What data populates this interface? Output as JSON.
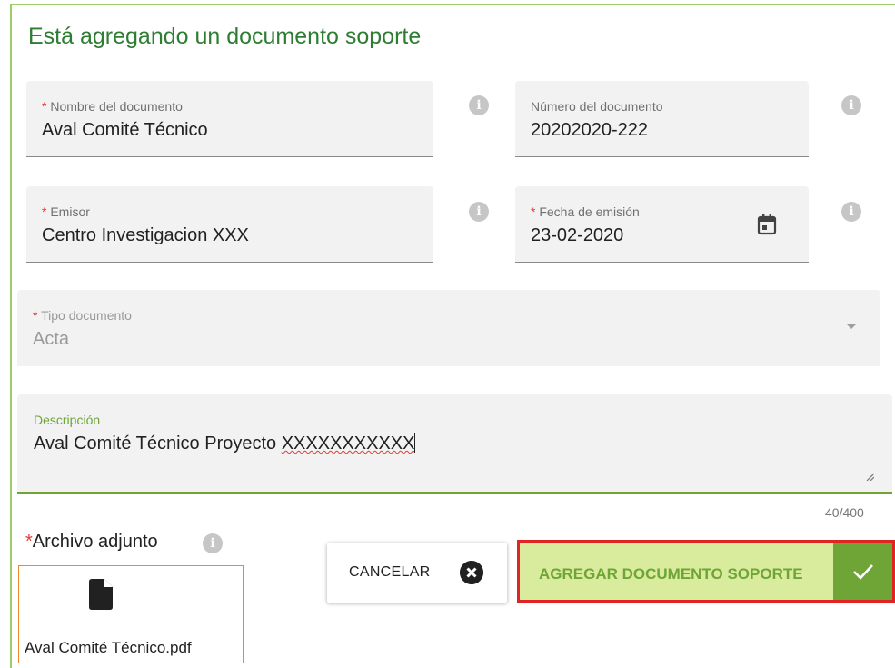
{
  "dialog": {
    "title": "Está agregando un documento soporte"
  },
  "fields": {
    "nombre": {
      "required": "*",
      "label": "Nombre del documento",
      "value": "Aval Comité Técnico"
    },
    "numero": {
      "label": "Número del documento",
      "value": "20202020-222"
    },
    "emisor": {
      "required": "*",
      "label": "Emisor",
      "value": "Centro Investigacion XXX"
    },
    "fecha": {
      "required": "*",
      "label": "Fecha de emisión",
      "value": "23-02-2020"
    },
    "tipo": {
      "required": "*",
      "label": "Tipo documento",
      "value": "Acta"
    },
    "descripcion": {
      "label": "Descripción",
      "value_prefix": "Aval Comité Técnico Proyecto ",
      "value_misspelled": "XXXXXXXXXXX",
      "counter": "40/400"
    }
  },
  "attachment": {
    "required": "*",
    "label": "Archivo adjunto",
    "file_name": "Aval Comité Técnico.pdf",
    "file_icon": "document-icon"
  },
  "buttons": {
    "cancel_label": "CANCELAR",
    "cancel_icon": "close-circle-icon",
    "add_label": "AGREGAR DOCUMENTO SOPORTE",
    "add_icon": "check-icon"
  },
  "icons": {
    "info": "i",
    "calendar": "calendar-icon",
    "dropdown": "chevron-down-icon"
  },
  "colors": {
    "accent_green": "#6ea536",
    "title_green": "#2e7d32",
    "highlight_red": "#e02424",
    "required_red": "#e53935",
    "file_border_orange": "#ef8a2c"
  }
}
